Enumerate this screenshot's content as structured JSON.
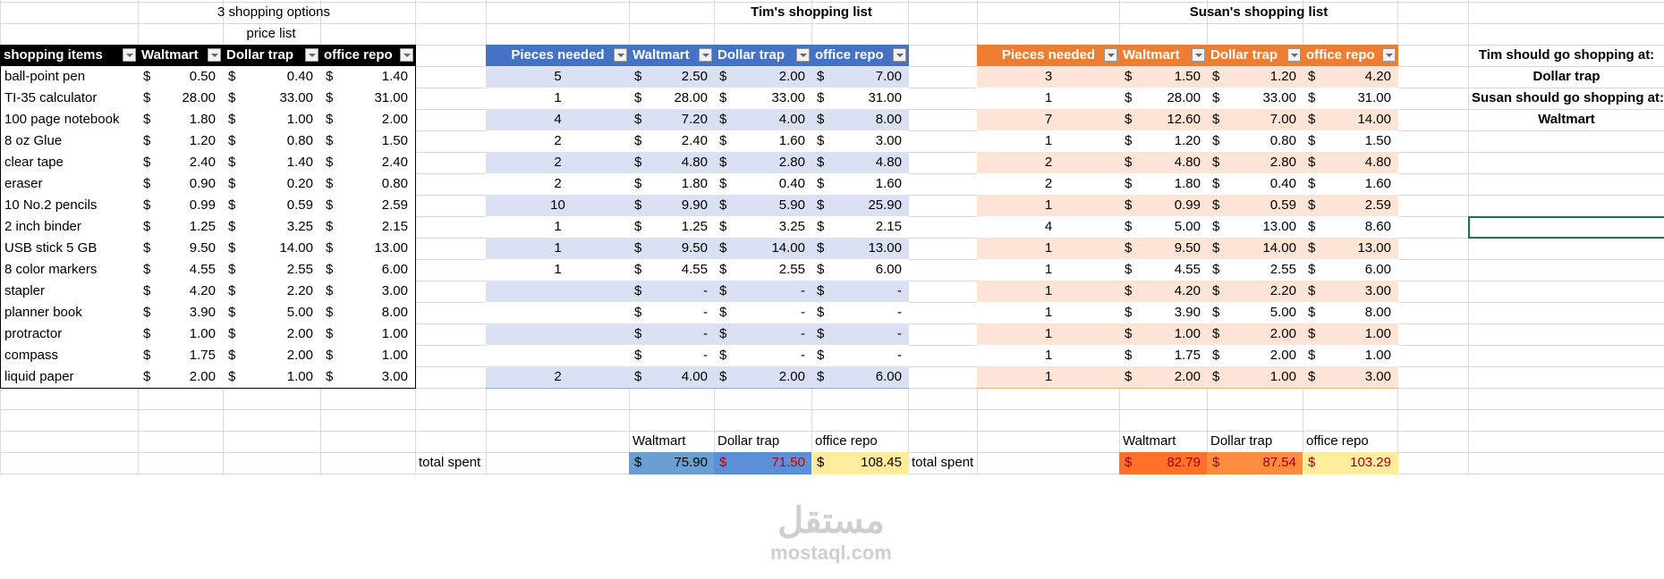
{
  "price_list": {
    "title": "3 shopping options",
    "subtitle": "price list",
    "headers": [
      "shopping items",
      "Waltmart",
      "Dollar trap",
      "office repo"
    ],
    "rows": [
      [
        "ball-point pen",
        "0.50",
        "0.40",
        "1.40"
      ],
      [
        "TI-35 calculator",
        "28.00",
        "33.00",
        "31.00"
      ],
      [
        "100 page notebook",
        "1.80",
        "1.00",
        "2.00"
      ],
      [
        "8 oz Glue",
        "1.20",
        "0.80",
        "1.50"
      ],
      [
        "clear tape",
        "2.40",
        "1.40",
        "2.40"
      ],
      [
        "eraser",
        "0.90",
        "0.20",
        "0.80"
      ],
      [
        "10 No.2 pencils",
        "0.99",
        "0.59",
        "2.59"
      ],
      [
        "2 inch binder",
        "1.25",
        "3.25",
        "2.15"
      ],
      [
        "USB stick 5 GB",
        "9.50",
        "14.00",
        "13.00"
      ],
      [
        "8 color markers",
        "4.55",
        "2.55",
        "6.00"
      ],
      [
        "stapler",
        "4.20",
        "2.20",
        "3.00"
      ],
      [
        "planner book",
        "3.90",
        "5.00",
        "8.00"
      ],
      [
        "protractor",
        "1.00",
        "2.00",
        "1.00"
      ],
      [
        "compass",
        "1.75",
        "2.00",
        "1.00"
      ],
      [
        "liquid paper",
        "2.00",
        "1.00",
        "3.00"
      ]
    ]
  },
  "currency": "$",
  "tim": {
    "title": "Tim's shopping list",
    "headers": [
      "Pieces needed",
      "Waltmart",
      "Dollar trap",
      "office repo"
    ],
    "rows": [
      [
        "5",
        "2.50",
        "2.00",
        "7.00"
      ],
      [
        "1",
        "28.00",
        "33.00",
        "31.00"
      ],
      [
        "4",
        "7.20",
        "4.00",
        "8.00"
      ],
      [
        "2",
        "2.40",
        "1.60",
        "3.00"
      ],
      [
        "2",
        "4.80",
        "2.80",
        "4.80"
      ],
      [
        "2",
        "1.80",
        "0.40",
        "1.60"
      ],
      [
        "10",
        "9.90",
        "5.90",
        "25.90"
      ],
      [
        "1",
        "1.25",
        "3.25",
        "2.15"
      ],
      [
        "1",
        "9.50",
        "14.00",
        "13.00"
      ],
      [
        "1",
        "4.55",
        "2.55",
        "6.00"
      ],
      [
        "",
        "-",
        "-",
        "-"
      ],
      [
        "",
        "-",
        "-",
        "-"
      ],
      [
        "",
        "-",
        "-",
        "-"
      ],
      [
        "",
        "-",
        "-",
        "-"
      ],
      [
        "2",
        "4.00",
        "2.00",
        "6.00"
      ]
    ],
    "total_label": "total spent",
    "total_headers": [
      "Waltmart",
      "Dollar trap",
      "office repo"
    ],
    "totals": [
      "75.90",
      "71.50",
      "108.45"
    ],
    "total_colors": [
      "#6A9FD2",
      "#5B8FD8",
      "#FFEB9C"
    ],
    "total_text_colors": [
      "#000000",
      "#C00000",
      "#000000"
    ]
  },
  "susan": {
    "title": "Susan's shopping list",
    "headers": [
      "Pieces needed",
      "Waltmart",
      "Dollar trap",
      "office repo"
    ],
    "rows": [
      [
        "3",
        "1.50",
        "1.20",
        "4.20"
      ],
      [
        "1",
        "28.00",
        "33.00",
        "31.00"
      ],
      [
        "7",
        "12.60",
        "7.00",
        "14.00"
      ],
      [
        "1",
        "1.20",
        "0.80",
        "1.50"
      ],
      [
        "2",
        "4.80",
        "2.80",
        "4.80"
      ],
      [
        "2",
        "1.80",
        "0.40",
        "1.60"
      ],
      [
        "1",
        "0.99",
        "0.59",
        "2.59"
      ],
      [
        "4",
        "5.00",
        "13.00",
        "8.60"
      ],
      [
        "1",
        "9.50",
        "14.00",
        "13.00"
      ],
      [
        "1",
        "4.55",
        "2.55",
        "6.00"
      ],
      [
        "1",
        "4.20",
        "2.20",
        "3.00"
      ],
      [
        "1",
        "3.90",
        "5.00",
        "8.00"
      ],
      [
        "1",
        "1.00",
        "2.00",
        "1.00"
      ],
      [
        "1",
        "1.75",
        "2.00",
        "1.00"
      ],
      [
        "1",
        "2.00",
        "1.00",
        "3.00"
      ]
    ],
    "total_label": "total spent",
    "total_headers": [
      "Waltmart",
      "Dollar trap",
      "office repo"
    ],
    "totals": [
      "82.79",
      "87.54",
      "103.29"
    ],
    "total_colors": [
      "#FF7128",
      "#FF8C3F",
      "#FFEB9C"
    ],
    "total_text_colors": [
      "#9C0006",
      "#9C0006",
      "#9C0006"
    ]
  },
  "summary": [
    "Tim should go shopping at:",
    "Dollar trap",
    "Susan should go shopping at:",
    "Waltmart"
  ],
  "watermark": {
    "arabic": "مستقل",
    "latin": "mostaql.com"
  }
}
